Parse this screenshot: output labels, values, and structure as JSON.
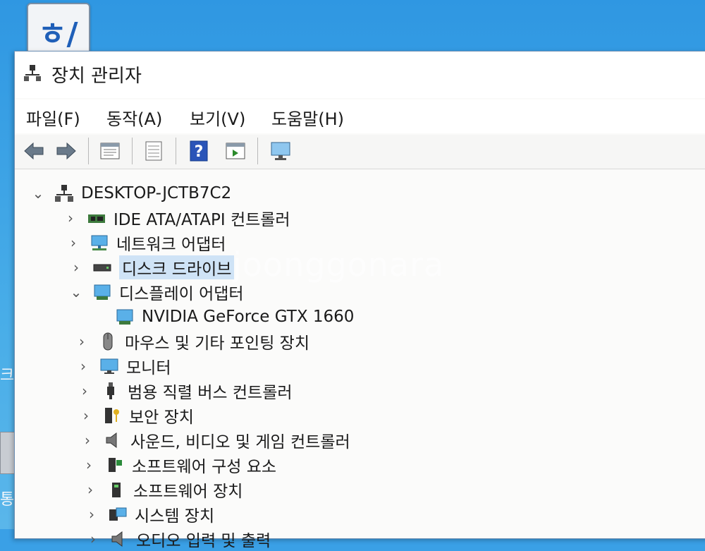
{
  "window": {
    "title": "장치 관리자"
  },
  "menu": [
    "파일(F)",
    "동작(A)",
    "보기(V)",
    "도움말(H)"
  ],
  "toolbar": {
    "buttons": [
      "back-arrow-icon",
      "forward-arrow-icon",
      "properties-icon",
      "list-icon",
      "help-icon",
      "run-icon",
      "monitor-icon"
    ]
  },
  "tree": {
    "root": "DESKTOP-JCTB7C2",
    "items": [
      {
        "label": "IDE ATA/ATAPI 컨트롤러",
        "icon": "ide-controller-icon",
        "expanded": false
      },
      {
        "label": "네트워크 어댑터",
        "icon": "network-adapter-icon",
        "expanded": false
      },
      {
        "label": "디스크 드라이브",
        "icon": "disk-drive-icon",
        "expanded": false,
        "selected": true
      },
      {
        "label": "디스플레이 어댑터",
        "icon": "display-adapter-icon",
        "expanded": true
      },
      {
        "label": "NVIDIA GeForce GTX 1660",
        "icon": "gpu-icon",
        "child": true
      },
      {
        "label": "마우스 및 기타 포인팅 장치",
        "icon": "mouse-icon",
        "expanded": false
      },
      {
        "label": "모니터",
        "icon": "monitor-icon",
        "expanded": false
      },
      {
        "label": "범용 직렬 버스 컨트롤러",
        "icon": "usb-icon",
        "expanded": false
      },
      {
        "label": "보안 장치",
        "icon": "security-key-icon",
        "expanded": false
      },
      {
        "label": "사운드, 비디오 및 게임 컨트롤러",
        "icon": "speaker-icon",
        "expanded": false
      },
      {
        "label": "소프트웨어 구성 요소",
        "icon": "software-component-icon",
        "expanded": false
      },
      {
        "label": "소프트웨어 장치",
        "icon": "software-device-icon",
        "expanded": false
      },
      {
        "label": "시스템 장치",
        "icon": "system-device-icon",
        "expanded": false
      },
      {
        "label": "오디오 입력 및 출력",
        "icon": "audio-io-icon",
        "expanded": false
      }
    ]
  },
  "desktop": {
    "edge_texts": [
      "크",
      "통"
    ]
  },
  "watermark": "joonggonara"
}
